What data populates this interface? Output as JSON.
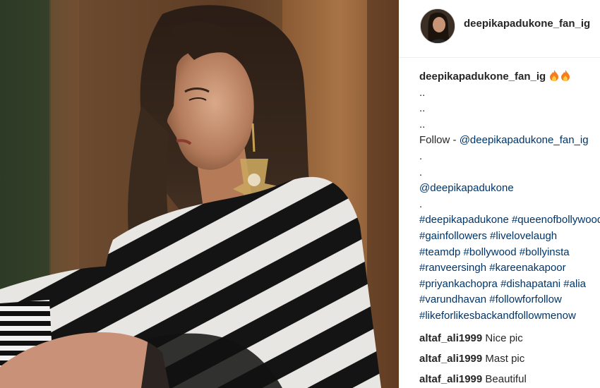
{
  "post": {
    "username": "deepikapadukone_fan_ig",
    "caption": {
      "username": "deepikapadukone_fan_ig",
      "emoji": "🔥🔥",
      "lines": [
        {
          "type": "text",
          "text": ".."
        },
        {
          "type": "text",
          "text": ".."
        },
        {
          "type": "text",
          "text": ".."
        },
        {
          "type": "follow",
          "prefix": "Follow - ",
          "mention": "@deepikapadukone_fan_ig"
        },
        {
          "type": "text",
          "text": "."
        },
        {
          "type": "text",
          "text": "."
        },
        {
          "type": "mention",
          "text": "@deepikapadukone"
        },
        {
          "type": "text",
          "text": "."
        },
        {
          "type": "tags",
          "text": "#deepikapadukone #queenofbollywood"
        },
        {
          "type": "tags",
          "text": "#gainfollowers #livelovelaugh"
        },
        {
          "type": "tags",
          "text": "#teamdp #bollywood #bollyinsta"
        },
        {
          "type": "tags",
          "text": "#ranveersingh #kareenakapoor"
        },
        {
          "type": "tags",
          "text": "#priyankachopra #dishapatani #alia"
        },
        {
          "type": "tags",
          "text": "#varundhavan #followforfollow"
        },
        {
          "type": "tags",
          "text": "#likeforlikesbackandfollowmenow"
        }
      ]
    },
    "comments": [
      {
        "user": "altaf_ali1999",
        "text": "Nice pic"
      },
      {
        "user": "altaf_ali1999",
        "text": "Mast pic"
      },
      {
        "user": "altaf_ali1999",
        "text": "Beautiful"
      }
    ]
  },
  "colors": {
    "link": "#003569",
    "text": "#262626",
    "divider": "#efefef"
  }
}
